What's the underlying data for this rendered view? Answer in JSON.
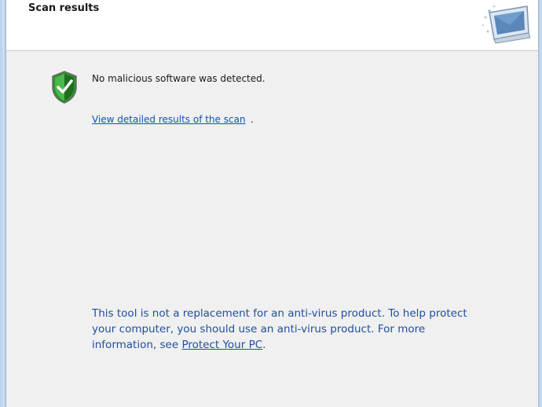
{
  "header": {
    "title": "Scan results"
  },
  "result": {
    "status_text": "No malicious software was detected.",
    "details_link": "View detailed results of the scan",
    "details_suffix": "."
  },
  "disclaimer": {
    "text_before_link": "This tool is not a replacement for an anti-virus product. To help protect your computer, you should use an anti-virus product. For more information, see ",
    "link_text": "Protect Your PC",
    "text_after_link": "."
  },
  "icons": {
    "shield": "shield-check-icon",
    "logo": "computer-scan-icon"
  },
  "colors": {
    "link": "#0b54b8",
    "disclaimer": "#1f4e9e",
    "shield_green": "#3aa63a",
    "content_bg": "#f0f0f0"
  }
}
